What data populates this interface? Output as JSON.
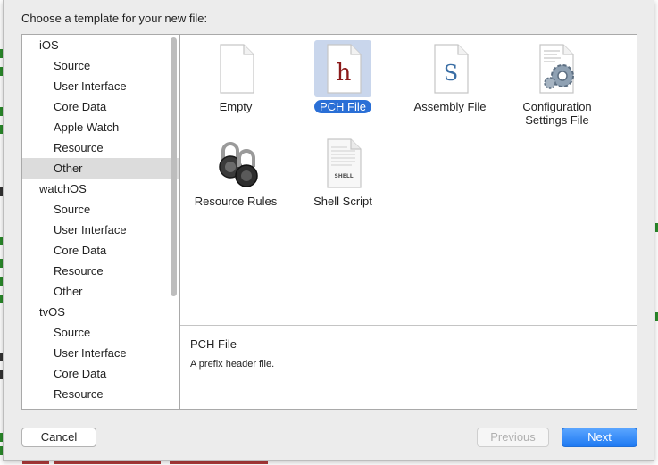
{
  "dialog": {
    "title": "Choose a template for your new file:"
  },
  "sidebar": {
    "groups": [
      {
        "label": "iOS",
        "items": [
          "Source",
          "User Interface",
          "Core Data",
          "Apple Watch",
          "Resource",
          "Other"
        ]
      },
      {
        "label": "watchOS",
        "items": [
          "Source",
          "User Interface",
          "Core Data",
          "Resource",
          "Other"
        ]
      },
      {
        "label": "tvOS",
        "items": [
          "Source",
          "User Interface",
          "Core Data",
          "Resource"
        ]
      }
    ],
    "selected": "iOS / Other"
  },
  "templates": [
    {
      "label": "Empty",
      "icon": "blank-file-icon"
    },
    {
      "label": "PCH File",
      "icon": "pch-file-icon",
      "glyph": "h",
      "selected": true
    },
    {
      "label": "Assembly File",
      "icon": "assembly-file-icon",
      "glyph": "S"
    },
    {
      "label": "Configuration Settings File",
      "icon": "config-settings-icon"
    },
    {
      "label": "Resource Rules",
      "icon": "padlocks-icon"
    },
    {
      "label": "Shell Script",
      "icon": "shell-script-icon",
      "glyph": "SHELL"
    }
  ],
  "description": {
    "title": "PCH File",
    "text": "A prefix header file."
  },
  "buttons": {
    "cancel": "Cancel",
    "previous": "Previous",
    "next": "Next"
  },
  "colors": {
    "accent": "#2a6fd6",
    "selection_bg": "#c9d6ec",
    "pch_glyph": "#8b1a1a",
    "asm_glyph": "#3a6ea5"
  }
}
